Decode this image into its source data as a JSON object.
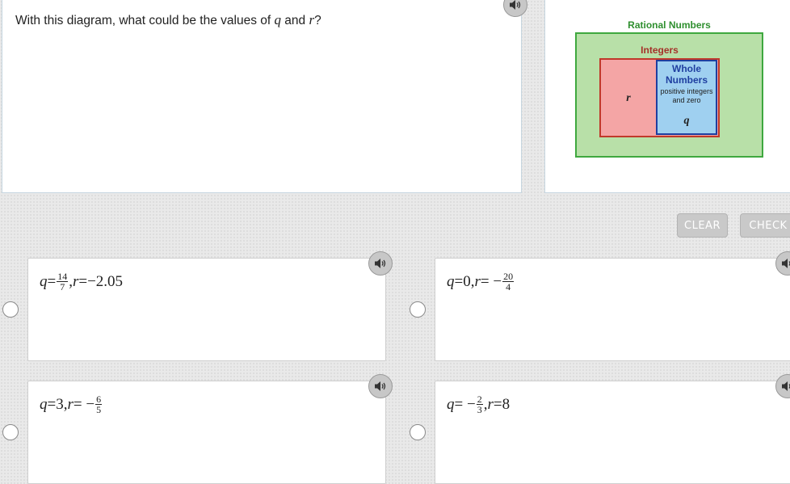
{
  "question": {
    "prefix": "With this diagram, what could be the values of ",
    "var_q": "q",
    "and": " and ",
    "var_r": "r",
    "suffix": "?"
  },
  "diagram": {
    "rational_label": "Rational Numbers",
    "integers_label": "Integers",
    "whole_label_1": "Whole",
    "whole_label_2": "Numbers",
    "whole_sub_1": "positive integers",
    "whole_sub_2": "and zero",
    "r_label": "r",
    "q_label": "q",
    "colors": {
      "rational_fill": "#b8e0a8",
      "rational_border": "#3fa83f",
      "rational_text": "#2f8f2f",
      "integers_fill": "#f4a5a5",
      "integers_border": "#c0392b",
      "integers_text": "#a5322a",
      "whole_fill": "#9fd0f0",
      "whole_border": "#1f3fa0",
      "whole_text": "#1f3fa0"
    }
  },
  "buttons": {
    "clear": "CLEAR",
    "check": "CHECK"
  },
  "icons": {
    "speaker": "speaker-icon"
  },
  "options": [
    {
      "q_text": "q",
      "eq1": " = ",
      "q_num": "14",
      "q_den": "7",
      "comma": ", ",
      "r_text": "r",
      "eq2": " = ",
      "r_val": "−2.05"
    },
    {
      "q_text": "q",
      "eq1": " = ",
      "q_val": "0",
      "comma": ", ",
      "r_text": "r",
      "eq2": " = −",
      "r_num": "20",
      "r_den": "4"
    },
    {
      "q_text": "q",
      "eq1": " = ",
      "q_val": "3",
      "comma": ", ",
      "r_text": "r",
      "eq2": " = −",
      "r_num": "6",
      "r_den": "5"
    },
    {
      "q_text": "q",
      "eq1": " = −",
      "q_num": "2",
      "q_den": "3",
      "comma": ", ",
      "r_text": "r",
      "eq2": " = ",
      "r_val": "8"
    }
  ]
}
